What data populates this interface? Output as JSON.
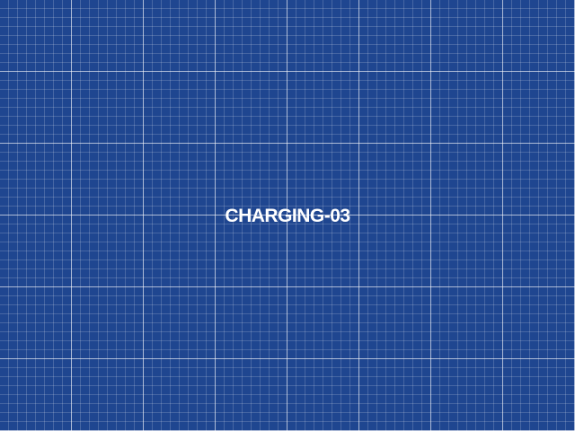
{
  "screen": {
    "label": "CHARGING-03",
    "background_color": "#1f4690",
    "grid_color": "#ffffff",
    "text_color": "#ffffff"
  }
}
